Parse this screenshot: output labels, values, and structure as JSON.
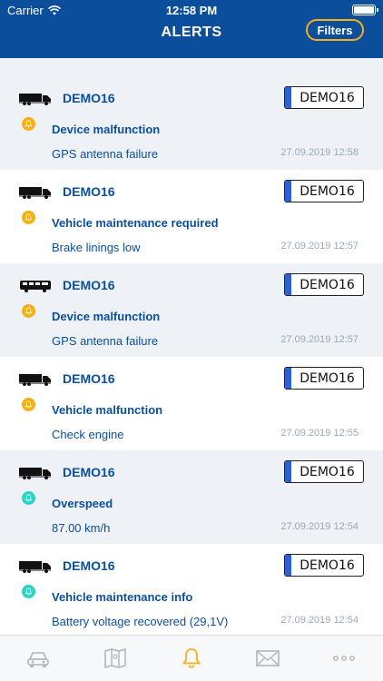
{
  "status_bar": {
    "carrier": "Carrier",
    "time": "12:58 PM"
  },
  "header": {
    "title": "ALERTS",
    "filters_label": "Filters"
  },
  "colors": {
    "header_bg": "#0b4f9c",
    "accent": "#f5b018",
    "info": "#2bd3c0",
    "plate_blue": "#2f5fd6"
  },
  "alerts": [
    {
      "vehicle": "DEMO16",
      "vehicle_icon": "truck-icon",
      "plate": "DEMO16",
      "severity": "warn",
      "type": "Device malfunction",
      "detail": "GPS antenna failure",
      "time": "27.09.2019 12:58"
    },
    {
      "vehicle": "DEMO16",
      "vehicle_icon": "truck-icon",
      "plate": "DEMO16",
      "severity": "warn",
      "type": "Vehicle maintenance required",
      "detail": "Brake linings low",
      "time": "27.09.2019 12:57"
    },
    {
      "vehicle": "DEMO16",
      "vehicle_icon": "bus-icon",
      "plate": "DEMO16",
      "severity": "warn",
      "type": "Device malfunction",
      "detail": "GPS antenna failure",
      "time": "27.09.2019 12:57"
    },
    {
      "vehicle": "DEMO16",
      "vehicle_icon": "truck-icon",
      "plate": "DEMO16",
      "severity": "warn",
      "type": "Vehicle malfunction",
      "detail": "Check engine",
      "time": "27.09.2019 12:55"
    },
    {
      "vehicle": "DEMO16",
      "vehicle_icon": "truck-icon",
      "plate": "DEMO16",
      "severity": "info",
      "type": "Overspeed",
      "detail": "87.00 km/h",
      "time": "27.09.2019 12:54"
    },
    {
      "vehicle": "DEMO16",
      "vehicle_icon": "truck-icon",
      "plate": "DEMO16",
      "severity": "info",
      "type": "Vehicle maintenance info",
      "detail": "Battery voltage recovered (29,1V)",
      "time": "27.09.2019 12:54"
    }
  ],
  "tabbar": {
    "tabs": [
      {
        "icon": "car-icon",
        "active": false
      },
      {
        "icon": "map-icon",
        "active": false
      },
      {
        "icon": "bell-icon",
        "active": true
      },
      {
        "icon": "envelope-icon",
        "active": false
      },
      {
        "icon": "more-icon",
        "active": false
      }
    ]
  }
}
